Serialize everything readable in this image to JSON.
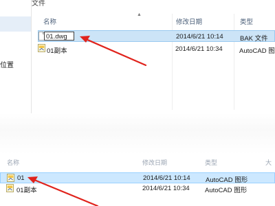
{
  "top_window": {
    "title": "BAK文件",
    "nav_label": "位置",
    "columns": {
      "name": "名称",
      "modified": "修改日期",
      "type": "类型"
    },
    "rows": [
      {
        "name": "01.dwg",
        "modified": "2014/6/21 10:14",
        "type": "BAK 文件",
        "icon": "blank-file-icon",
        "editing": true
      },
      {
        "name": "01副本",
        "modified": "2014/6/21 10:34",
        "type": "AutoCAD 图",
        "icon": "autocad-file-icon",
        "editing": false
      }
    ]
  },
  "bottom_window": {
    "columns": {
      "name": "名称",
      "modified": "修改日期",
      "type": "类型"
    },
    "rows": [
      {
        "name": "01",
        "modified": "2014/6/21 10:14",
        "type": "AutoCAD 图形",
        "icon": "autocad-file-icon",
        "selected": true
      },
      {
        "name": "01副本",
        "modified": "2014/6/21 10:34",
        "type": "AutoCAD 图形",
        "icon": "autocad-file-icon",
        "selected": false
      },
      {
        "name": "",
        "modified": "",
        "type": "",
        "icon": "",
        "selected": false
      }
    ]
  },
  "colors": {
    "selection": "#cce4f7",
    "selection_border": "#99c9ef",
    "annotation_arrow": "#e0231c",
    "header_text": "#4c607a"
  }
}
